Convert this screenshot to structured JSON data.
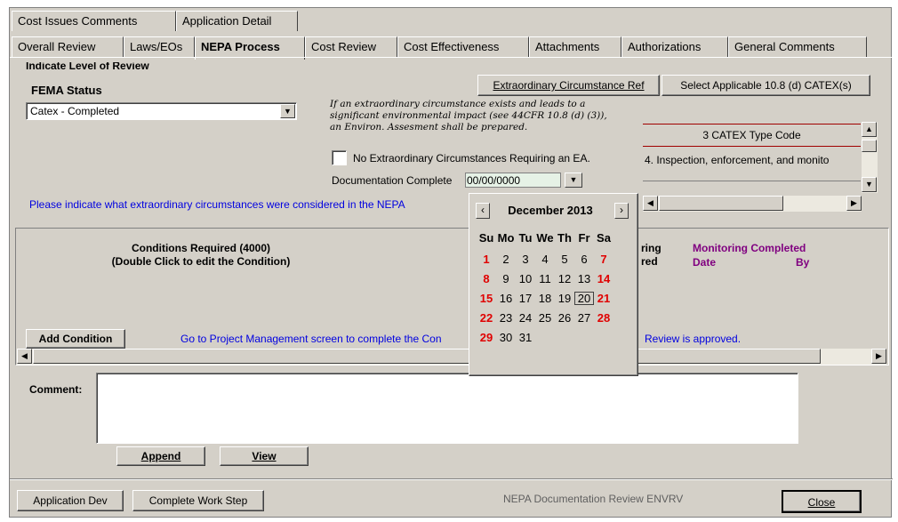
{
  "tabs_row1": [
    "Cost Issues Comments",
    "Application Detail"
  ],
  "tabs_row2": [
    "Overall Review",
    "Laws/EOs",
    "NEPA Process",
    "Cost Review",
    "Cost Effectiveness",
    "Attachments",
    "Authorizations",
    "General Comments"
  ],
  "section_heading": "Indicate Level of Review",
  "fema_status": {
    "label": "FEMA Status",
    "value": "Catex - Completed"
  },
  "buttons": {
    "extraordinary_ref": "Extraordinary Circumstance Ref",
    "select_catex": "Select Applicable 10.8 (d) CATEX(s)",
    "add_condition": "Add Condition",
    "append": "Append",
    "view": "View",
    "application_dev": "Application Dev",
    "complete_work_step": "Complete Work Step",
    "close": "Close"
  },
  "notice_text": "If an extraordinary circumstance exists and leads to a significant environmental impact (see 44CFR 10.8 (d) (3)), an Environ. Assesment shall be prepared.",
  "no_extraordinary_label": "No Extraordinary Circumstances Requiring an EA.",
  "documentation_complete": {
    "label": "Documentation Complete",
    "value": "00/00/0000"
  },
  "catex_list": {
    "header": "3  CATEX Type Code",
    "row": "4. Inspection, enforcement, and monito"
  },
  "please_indicate_text": "Please indicate what extraordinary circumstances were considered in the NEPA",
  "conditions": {
    "title_line1": "Conditions Required (4000)",
    "title_line2": "(Double Click to edit the Condition)",
    "partial_col_line1": "ring",
    "partial_col_line2": "red",
    "monitoring_completed": "Monitoring Completed",
    "date_col": "Date",
    "by_col": "By",
    "goto_text_left": "Go to Project Management screen to complete the Con",
    "goto_text_right": "Review is approved."
  },
  "comment_label": "Comment:",
  "footer_status": "NEPA Documentation Review  ENVRV",
  "calendar": {
    "month_label": "December 2013",
    "weekdays": [
      "Su",
      "Mo",
      "Tu",
      "We",
      "Th",
      "Fr",
      "Sa"
    ],
    "weeks": [
      [
        "1",
        "2",
        "3",
        "4",
        "5",
        "6",
        "7"
      ],
      [
        "8",
        "9",
        "10",
        "11",
        "12",
        "13",
        "14"
      ],
      [
        "15",
        "16",
        "17",
        "18",
        "19",
        "20",
        "21"
      ],
      [
        "22",
        "23",
        "24",
        "25",
        "26",
        "27",
        "28"
      ],
      [
        "29",
        "30",
        "31",
        "",
        "",
        "",
        ""
      ]
    ],
    "selected_day": "20"
  }
}
